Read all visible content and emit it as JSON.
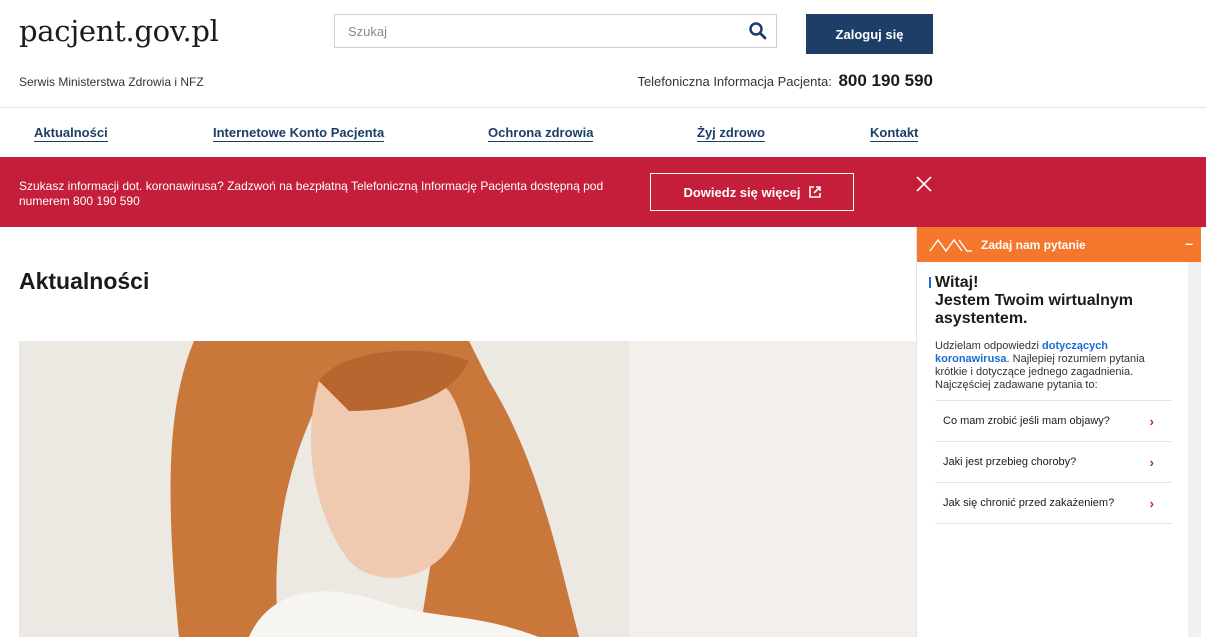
{
  "header": {
    "logo": "pacjent.gov.pl",
    "tagline": "Serwis Ministerstwa Zdrowia i NFZ",
    "search_placeholder": "Szukaj",
    "login_label": "Zaloguj się",
    "phone_label": "Telefoniczna Informacja Pacjenta:",
    "phone_number": "800 190 590"
  },
  "nav": {
    "items": [
      {
        "label": "Aktualności"
      },
      {
        "label": "Internetowe Konto Pacjenta"
      },
      {
        "label": "Ochrona zdrowia"
      },
      {
        "label": "Żyj zdrowo"
      },
      {
        "label": "Kontakt"
      }
    ]
  },
  "alert": {
    "text": "Szukasz informacji dot. koronawirusa? Zadzwoń na bezpłatną Telefoniczną Informację Pacjenta dostępną pod numerem 800 190 590",
    "button_label": "Dowiedz się więcej"
  },
  "main": {
    "title": "Aktualności"
  },
  "chat": {
    "title": "Zadaj nam pytanie",
    "minimize": "–",
    "greeting_1": "Witaj!",
    "greeting_2": "Jestem Twoim wirtualnym asystentem.",
    "info_prefix": "Udzielam odpowiedzi ",
    "info_highlight": "dotyczących koronawirusa",
    "info_suffix": ". Najlepiej rozumiem pytania krótkie i dotyczące jednego zagadnienia. Najczęściej zadawane pytania to:",
    "questions": [
      {
        "label": "Co mam zrobić jeśli mam objawy?"
      },
      {
        "label": "Jaki jest przebieg choroby?"
      },
      {
        "label": "Jak się chronić przed zakażeniem?"
      }
    ]
  },
  "colors": {
    "brand_navy": "#1c3e67",
    "alert_red": "#c41e3a",
    "chat_orange": "#f5772b",
    "link_blue": "#1c6bd4"
  },
  "icons": {
    "search": "search-icon",
    "external": "external-link-icon",
    "close": "close-icon",
    "chat_logo": "wave-logo-icon",
    "chevron": "chevron-right-icon"
  }
}
